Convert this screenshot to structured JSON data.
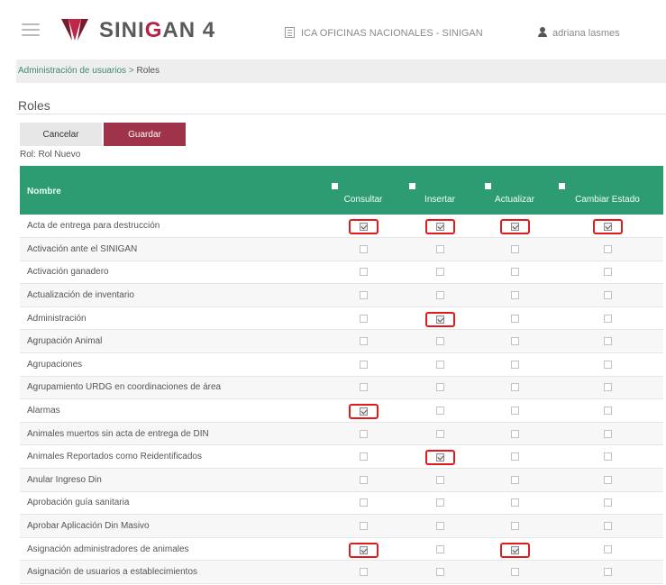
{
  "header": {
    "brand_left": "SINI",
    "brand_accent": "G",
    "brand_right": "AN",
    "brand_version": "4",
    "organization": "ICA OFICINAS NACIONALES - SINIGAN",
    "user": "adriana lasmes",
    "brand_color": "#b52342"
  },
  "breadcrumb": {
    "parent": "Administración de usuarios",
    "separator": ">",
    "current": "Roles"
  },
  "page": {
    "title": "Roles",
    "cancel_label": "Cancelar",
    "save_label": "Guardar",
    "rol_line": "Rol: Rol Nuevo"
  },
  "table": {
    "header_color": "#2e9c72",
    "name_header": "Nombre",
    "columns": [
      "Consultar",
      "Insertar",
      "Actualizar",
      "Cambiar Estado"
    ],
    "rows": [
      {
        "name": "Acta de entrega para destrucción",
        "checks": [
          true,
          true,
          true,
          true
        ]
      },
      {
        "name": "Activación ante el SINIGAN",
        "checks": [
          false,
          false,
          false,
          false
        ]
      },
      {
        "name": "Activación ganadero",
        "checks": [
          false,
          false,
          false,
          false
        ]
      },
      {
        "name": "Actualización de inventario",
        "checks": [
          false,
          false,
          false,
          false
        ]
      },
      {
        "name": "Administración",
        "checks": [
          false,
          true,
          false,
          false
        ]
      },
      {
        "name": "Agrupación Animal",
        "checks": [
          false,
          false,
          false,
          false
        ]
      },
      {
        "name": "Agrupaciones",
        "checks": [
          false,
          false,
          false,
          false
        ]
      },
      {
        "name": "Agrupamiento URDG en coordinaciones de área",
        "checks": [
          false,
          false,
          false,
          false
        ]
      },
      {
        "name": "Alarmas",
        "checks": [
          true,
          false,
          false,
          false
        ]
      },
      {
        "name": "Animales muertos sin acta de entrega de DIN",
        "checks": [
          false,
          false,
          false,
          false
        ]
      },
      {
        "name": "Animales Reportados como Reidentificados",
        "checks": [
          false,
          true,
          false,
          false
        ]
      },
      {
        "name": "Anular Ingreso Din",
        "checks": [
          false,
          false,
          false,
          false
        ]
      },
      {
        "name": "Aprobación guía sanitaria",
        "checks": [
          false,
          false,
          false,
          false
        ]
      },
      {
        "name": "Aprobar Aplicación Din Masivo",
        "checks": [
          false,
          false,
          false,
          false
        ]
      },
      {
        "name": "Asignación administradores de animales",
        "checks": [
          true,
          false,
          true,
          false
        ]
      },
      {
        "name": "Asignación de usuarios a establecimientos",
        "checks": [
          false,
          false,
          false,
          false
        ]
      }
    ]
  }
}
